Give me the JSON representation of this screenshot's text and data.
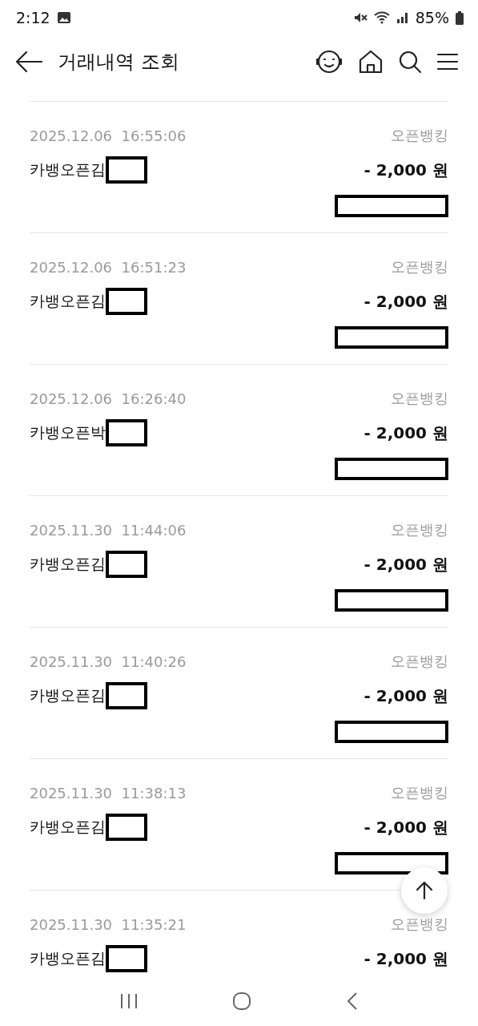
{
  "status_bar": {
    "time": "2:12",
    "battery": "85%"
  },
  "header": {
    "title": "거래내역 조회"
  },
  "transactions": [
    {
      "date": "2025.12.06",
      "time": "16:55:06",
      "channel": "오픈뱅킹",
      "name": "카뱅오픈김",
      "amount": "- 2,000 원"
    },
    {
      "date": "2025.12.06",
      "time": "16:51:23",
      "channel": "오픈뱅킹",
      "name": "카뱅오픈김",
      "amount": "- 2,000 원"
    },
    {
      "date": "2025.12.06",
      "time": "16:26:40",
      "channel": "오픈뱅킹",
      "name": "카뱅오픈박",
      "amount": "- 2,000 원"
    },
    {
      "date": "2025.11.30",
      "time": "11:44:06",
      "channel": "오픈뱅킹",
      "name": "카뱅오픈김",
      "amount": "- 2,000 원"
    },
    {
      "date": "2025.11.30",
      "time": "11:40:26",
      "channel": "오픈뱅킹",
      "name": "카뱅오픈김",
      "amount": "- 2,000 원"
    },
    {
      "date": "2025.11.30",
      "time": "11:38:13",
      "channel": "오픈뱅킹",
      "name": "카뱅오픈김",
      "amount": "- 2,000 원"
    },
    {
      "date": "2025.11.30",
      "time": "11:35:21",
      "channel": "오픈뱅킹",
      "name": "카뱅오픈김",
      "amount": "- 2,000 원"
    }
  ]
}
